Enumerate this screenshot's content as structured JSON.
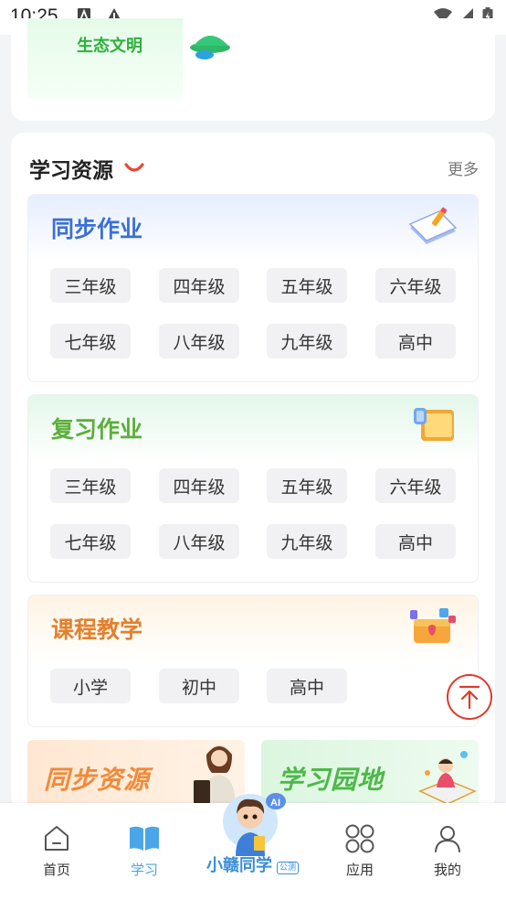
{
  "status_bar": {
    "time": "10:25"
  },
  "top_card": {
    "tile_label": "生态文明"
  },
  "resources": {
    "title": "学习资源",
    "more": "更多",
    "panels": [
      {
        "title": "同步作业",
        "title_color": "#3a6fd6",
        "bg": "#e6eefe",
        "grades": [
          "三年级",
          "四年级",
          "五年级",
          "六年级",
          "七年级",
          "八年级",
          "九年级",
          "高中"
        ]
      },
      {
        "title": "复习作业",
        "title_color": "#5cae3a",
        "bg": "#e3f7ea",
        "grades": [
          "三年级",
          "四年级",
          "五年级",
          "六年级",
          "七年级",
          "八年级",
          "九年级",
          "高中"
        ]
      },
      {
        "title": "课程教学",
        "title_color": "#e2812e",
        "bg": "#fff4e4",
        "levels": [
          "小学",
          "初中",
          "高中"
        ]
      }
    ],
    "banners": [
      {
        "text": "同步资源",
        "color": "#f08a3a"
      },
      {
        "text": "学习园地",
        "color": "#4db848"
      }
    ]
  },
  "tabbar": {
    "items": [
      {
        "label": "首页"
      },
      {
        "label": "学习"
      },
      {
        "label": "应用"
      },
      {
        "label": "我的"
      }
    ],
    "center": {
      "label": "小赣同学",
      "badge": "公测"
    }
  },
  "colors": {
    "accent": "#4aa6e8",
    "back_to_top": "#e03a2a"
  }
}
